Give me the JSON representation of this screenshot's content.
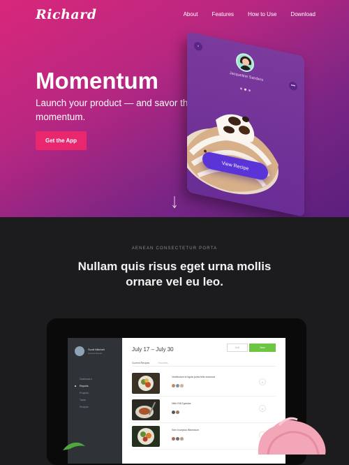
{
  "brand": {
    "logo": "Richard"
  },
  "nav": {
    "items": [
      "About",
      "Features",
      "How to Use",
      "Download"
    ]
  },
  "hero": {
    "title": "Momentum",
    "subtitle": "Launch your product — and savor the momentum.",
    "cta_label": "Get the App"
  },
  "phone": {
    "profile_name": "Jacqueline Sanders",
    "profile_sub": "",
    "view_button": "View Recipe"
  },
  "section2": {
    "eyebrow": "AENEAN CONSECTETUR PORTA",
    "heading": "Nullam quis risus eget urna mollis ornare vel eu leo."
  },
  "app": {
    "user_name": "Scott Mitchell",
    "user_role": "Account Expert",
    "menu": [
      "Dashboard",
      "Reports",
      "Projects",
      "Tasks",
      "Recipes"
    ],
    "active_menu": 1,
    "date_small": "",
    "date_range": "July 17 – July 30",
    "btn_view": "Edit",
    "btn_new": "New",
    "tabs": [
      "Current Recipes",
      "Favorites"
    ],
    "rows": [
      {
        "title": "Vestibulum id ligula porta felis euismod",
        "sub": ""
      },
      {
        "title": "Nibh Elit Egestas",
        "sub": ""
      },
      {
        "title": "Sem Inceptos Bibendum",
        "sub": ""
      }
    ]
  },
  "colors": {
    "hero_start": "#d8277a",
    "hero_end": "#5a1f7d",
    "cta": "#e8276f",
    "accent_green": "#6cc644",
    "recipe_button": "#5a34d6"
  }
}
